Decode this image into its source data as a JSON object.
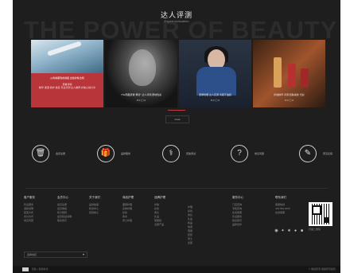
{
  "section": {
    "bg_text": "THE POWER OF BEAUTY",
    "title": "达人评测",
    "subtitle": "Expert evaluation"
  },
  "cards": [
    {
      "red_title": "从青春期到成熟肌 这些护肤法则",
      "red_sub": "查看详情",
      "red_body": "精华 保湿 修护 焕亮 专业评测 达人推荐 护肤心得分享",
      "caption": "",
      "meta": ""
    },
    {
      "caption": "YSL明星唇膏“黑管” 达人评测 质地色彩",
      "meta": "♥ 0  ◯ 0"
    },
    {
      "caption": "夏季防晒 达人实测 清爽不油腻",
      "meta": "♥ 0  ◯ 0"
    },
    {
      "caption": "护肤精华 评测 肌肤焕新 光彩",
      "meta": "♥ 0  ◯ 0"
    }
  ],
  "more_button": "more",
  "services": [
    {
      "icon": "trash-icon",
      "glyph": "🗑",
      "label": "会员注册"
    },
    {
      "icon": "gift-icon",
      "glyph": "🎁",
      "label": "品牌服务"
    },
    {
      "icon": "stethoscope-icon",
      "glyph": "⚕",
      "label": "皮肤测试"
    },
    {
      "icon": "question-icon",
      "glyph": "?",
      "label": "常见问题"
    },
    {
      "icon": "pen-icon",
      "glyph": "✎",
      "label": "意见反馈"
    }
  ],
  "footer": {
    "columns": [
      {
        "heading": "客户服务",
        "items": [
          "售后服务",
          "退换说明",
          "配送方式",
          "支付方式",
          "常见问题"
        ]
      },
      {
        "heading": "会员中心",
        "items": [
          "会员注册",
          "会员等级",
          "积分规则",
          "会员权益说明",
          "联系我们"
        ]
      },
      {
        "heading": "关于我们",
        "items": [
          "品牌故事",
          "新闻中心",
          "招贤纳士"
        ]
      },
      {
        "heading": "商品护理",
        "items": [
          "面部护理",
          "身体护理",
          "彩妆",
          "香水",
          "男士护理"
        ]
      },
      {
        "heading": "品牌护理",
        "items": [
          "护肤",
          "彩妆",
          "香氛",
          "礼盒",
          "限量版",
          "全部产品"
        ]
      },
      {
        "heading": "",
        "items": [
          "护理",
          "彩妆",
          "香氛",
          "礼盒",
          "新品",
          "热卖",
          "限量",
          "套装",
          "男士",
          "全部"
        ]
      },
      {
        "heading": "服务中心",
        "items": [
          "门店查询",
          "专柜查询",
          "在线客服",
          "售后服务",
          "联系我们",
          "品牌合作"
        ]
      },
      {
        "heading": "联系我们",
        "items": [
          "客服热线",
          "400-000-0000",
          "在线客服"
        ]
      }
    ],
    "qr_label": "扫描二维码",
    "socials": [
      "wechat-icon",
      "weibo-icon",
      "star-icon",
      "chat-icon",
      "mail-icon"
    ],
    "social_glyphs": [
      "◉",
      "✦",
      "★",
      "●",
      "■"
    ],
    "lang_select": "选择地区"
  },
  "bottom": {
    "left": "隐私  |  使用条款",
    "right": "© 版权所有 保留所有权利"
  }
}
